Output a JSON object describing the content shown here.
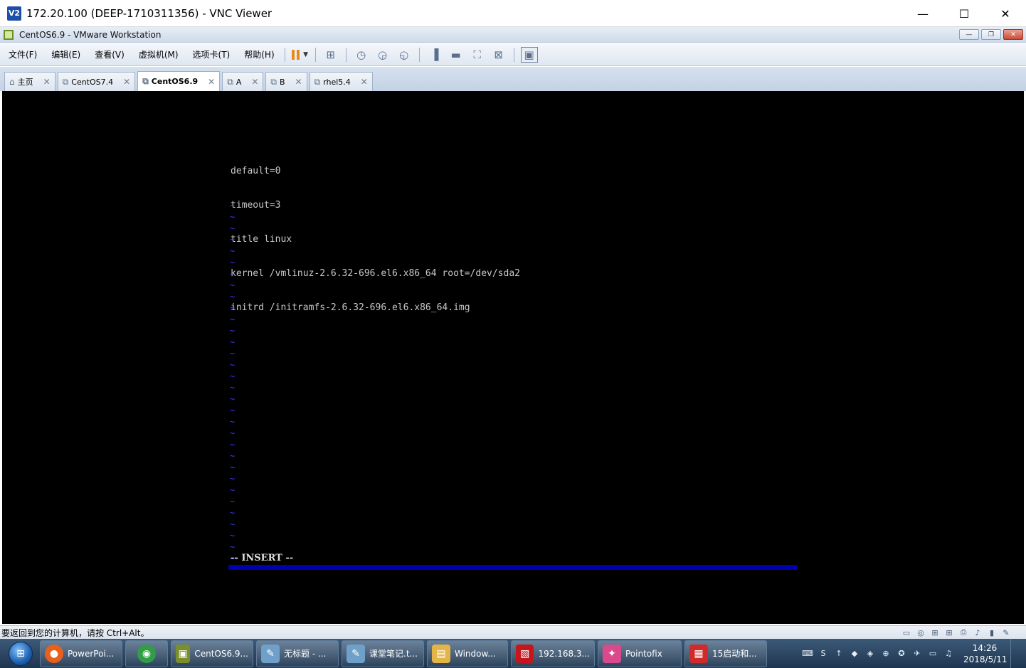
{
  "vnc_window": {
    "logo_text": "V2",
    "title": "172.20.100 (DEEP-1710311356) - VNC Viewer",
    "minimize": "—",
    "maximize": "☐",
    "close": "✕"
  },
  "vmware_window": {
    "title": "CentOS6.9 - VMware Workstation",
    "controls": [
      "—",
      "❐",
      "✕"
    ]
  },
  "menu": [
    "文件(F)",
    "编辑(E)",
    "查看(V)",
    "虚拟机(M)",
    "选项卡(T)",
    "帮助(H)"
  ],
  "toolbar": {
    "pause_accent": "#e8891a"
  },
  "tabs": [
    {
      "label": "主页",
      "icon": "home-icon"
    },
    {
      "label": "CentOS7.4",
      "icon": "vm-icon"
    },
    {
      "label": "CentOS6.9",
      "icon": "vm-icon",
      "active": true
    },
    {
      "label": "A",
      "icon": "vm-icon"
    },
    {
      "label": "B",
      "icon": "vm-icon"
    },
    {
      "label": "rhel5.4",
      "icon": "vm-icon"
    }
  ],
  "console": {
    "lines": [
      "default=0",
      "timeout=3",
      "title linux",
      "kernel /vmlinuz-2.6.32-696.el6.x86_64 root=/dev/sda2",
      "initrd /initramfs-2.6.32-696.el6.x86_64.img"
    ],
    "tilde": "~",
    "tilde_count": 32,
    "mode": "-- INSERT --",
    "text_color": "#c8c8c8",
    "tilde_color": "#3b3bff",
    "statusline_color": "#0000b0"
  },
  "vm_status": {
    "message": "要返回到您的计算机，请按 Ctrl+Alt。"
  },
  "taskbar": {
    "items": [
      {
        "label": "PowerPoi...",
        "icon": "firefox-icon",
        "color": "#e8601c"
      },
      {
        "label": "",
        "icon": "chrome-icon",
        "color": "#2f9e44"
      },
      {
        "label": "CentOS6.9...",
        "icon": "vmware-icon",
        "color": "#7a8f2a"
      },
      {
        "label": "无标题 - ...",
        "icon": "notepad-icon",
        "color": "#6fa0c9"
      },
      {
        "label": "课堂笔记.t...",
        "icon": "notepad-icon",
        "color": "#6fa0c9"
      },
      {
        "label": "Window...",
        "icon": "folder-icon",
        "color": "#e3b548"
      },
      {
        "label": "192.168.3...",
        "icon": "remote-icon",
        "color": "#c4161c"
      },
      {
        "label": "Pointofix",
        "icon": "pointofix-icon",
        "color": "#d94a8c"
      },
      {
        "label": "15启动和...",
        "icon": "pdf-icon",
        "color": "#d12a2a"
      }
    ],
    "clock_time": "14:26",
    "clock_date": "2018/5/11"
  }
}
